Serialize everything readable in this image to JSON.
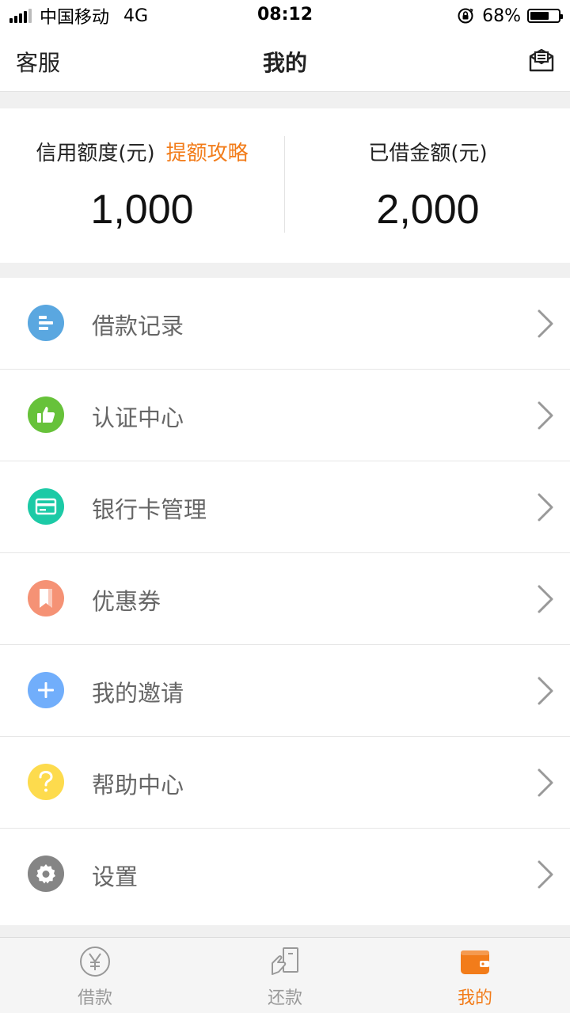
{
  "status_bar": {
    "carrier": "中国移动",
    "network": "4G",
    "time": "08:12",
    "battery_percent": "68%",
    "battery_level": 0.68
  },
  "nav": {
    "left_label": "客服",
    "title": "我的",
    "right_icon": "message-icon"
  },
  "credit": {
    "limit_label": "信用额度(元)",
    "tip_label": "提额攻略",
    "limit_value": "1,000",
    "borrowed_label": "已借金额(元)",
    "borrowed_value": "2,000"
  },
  "menu": {
    "items": [
      {
        "label": "借款记录",
        "icon": "record-icon",
        "color": "#5aa7e0"
      },
      {
        "label": "认证中心",
        "icon": "thumbs-up-icon",
        "color": "#67c23a"
      },
      {
        "label": "银行卡管理",
        "icon": "bank-card-icon",
        "color": "#1ccaa6"
      },
      {
        "label": "优惠券",
        "icon": "coupon-icon",
        "color": "#f59275"
      },
      {
        "label": "我的邀请",
        "icon": "plus-icon",
        "color": "#71aefb"
      },
      {
        "label": "帮助中心",
        "icon": "question-icon",
        "color": "#fddb4d"
      },
      {
        "label": "设置",
        "icon": "gear-icon",
        "color": "#858585"
      }
    ]
  },
  "tabs": [
    {
      "label": "借款",
      "icon": "yen-icon",
      "active": false
    },
    {
      "label": "还款",
      "icon": "repay-icon",
      "active": false
    },
    {
      "label": "我的",
      "icon": "wallet-icon",
      "active": true
    }
  ],
  "colors": {
    "accent": "#f27c1a",
    "background": "#f0f0f0"
  }
}
